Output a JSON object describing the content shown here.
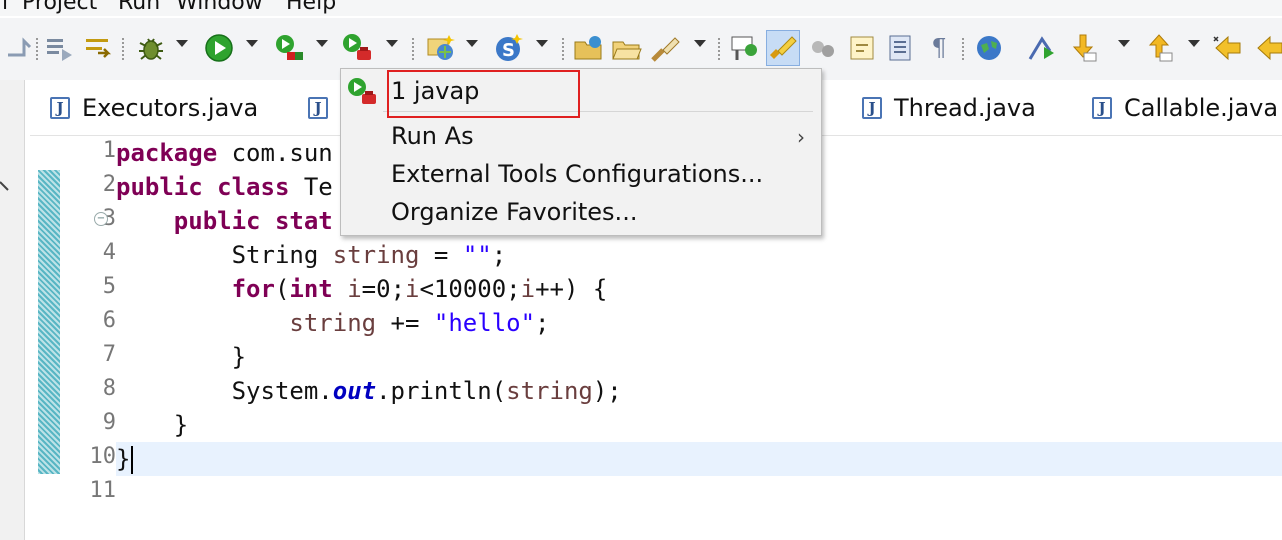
{
  "menubar": {
    "items": [
      "l",
      "Project",
      "Run",
      "Window",
      "Help"
    ]
  },
  "tabs": [
    {
      "label": "Executors.java"
    },
    {
      "label": ""
    },
    {
      "label": "Thread.java"
    },
    {
      "label": "Callable.java"
    }
  ],
  "editor": {
    "line_numbers": [
      "1",
      "2",
      "3",
      "4",
      "5",
      "6",
      "7",
      "8",
      "9",
      "10",
      "11"
    ],
    "code": {
      "l1_kw": "package",
      "l1_rest": " com.sun",
      "l2_kw1": "public",
      "l2_kw2": "class",
      "l2_rest": " Te",
      "l3_kw1": "public",
      "l3_kw2": "stat",
      "l4_a": "String ",
      "l4_var": "string",
      "l4_b": " = ",
      "l4_str": "\"\"",
      "l4_c": ";",
      "l5_kw1": "for",
      "l5_a": "(",
      "l5_kw2": "int",
      "l5_b": " ",
      "l5_v1": "i",
      "l5_c": "=0;",
      "l5_v2": "i",
      "l5_d": "<10000;",
      "l5_v3": "i",
      "l5_e": "++) {",
      "l6_var": "string",
      "l6_a": " += ",
      "l6_str": "\"hello\"",
      "l6_b": ";",
      "l7": "}",
      "l8_a": "System.",
      "l8_fld": "out",
      "l8_b": ".println(",
      "l8_var": "string",
      "l8_c": ");",
      "l9": "}",
      "l10": "}"
    }
  },
  "dropdown": {
    "items": [
      "1 javap",
      "Run As",
      "External Tools Configurations...",
      "Organize Favorites..."
    ]
  }
}
